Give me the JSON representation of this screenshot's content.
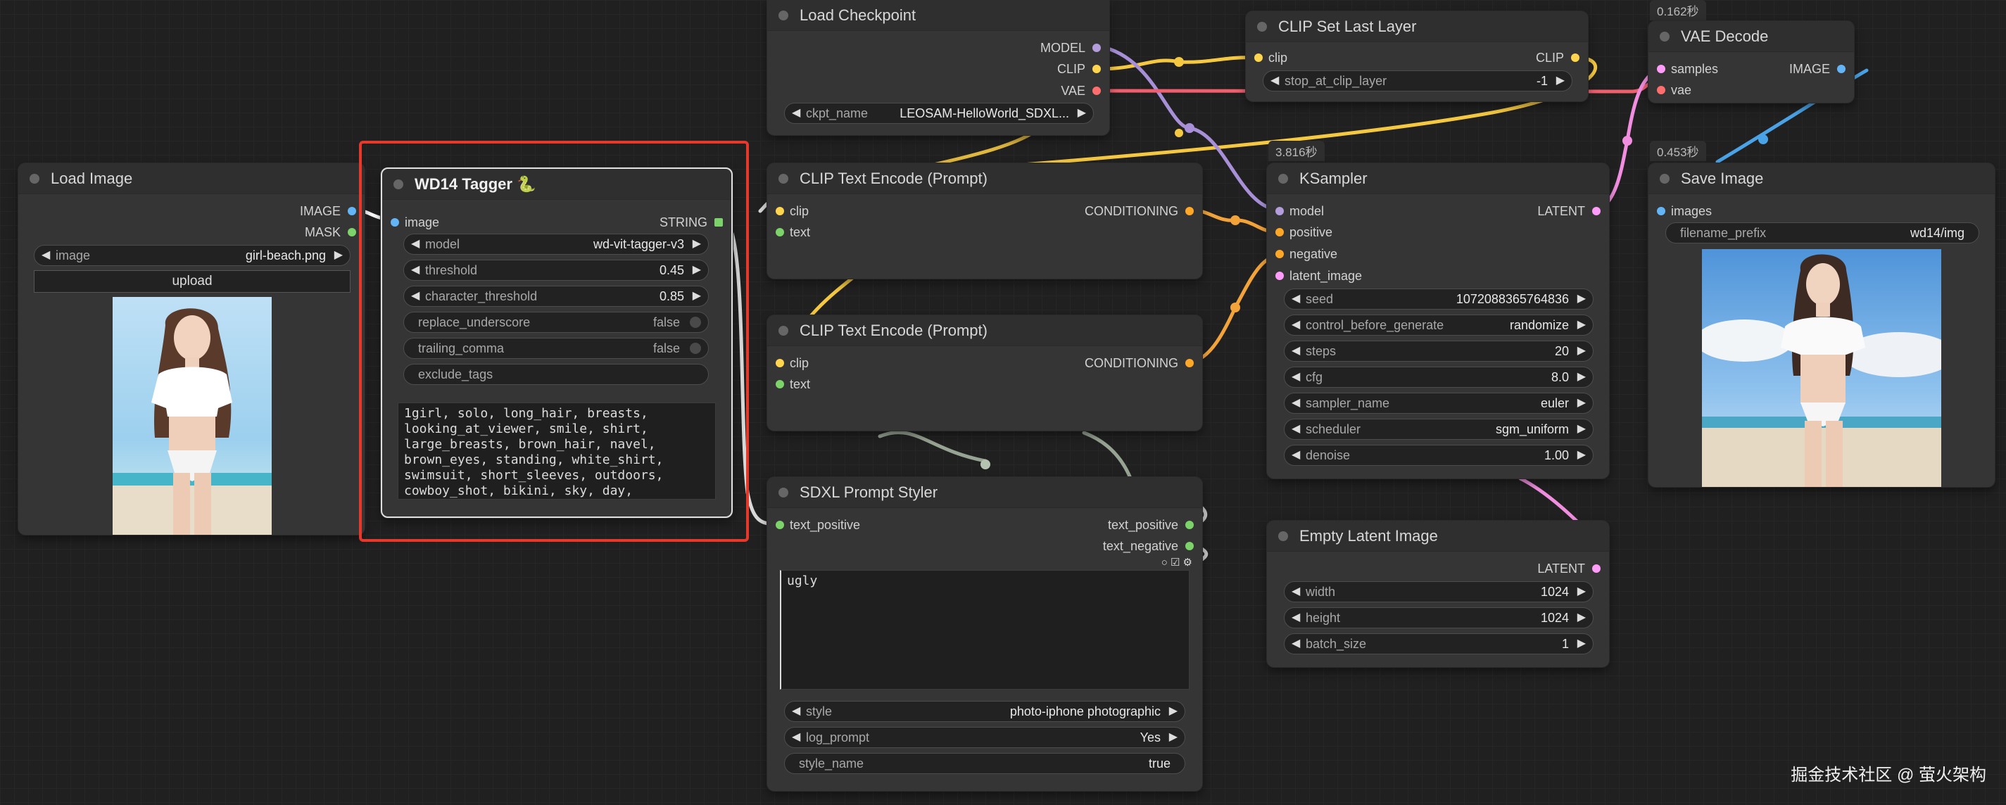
{
  "colors": {
    "model": "#b39ddb",
    "clip": "#ffd54f",
    "vae": "#ff6e6e",
    "conditioning": "#ffa726",
    "latent": "#ff9cf9",
    "image": "#64b5f6",
    "string": "#7bd36a",
    "highlight": "#e8382c"
  },
  "load_image": {
    "title": "Load Image",
    "out_image": "IMAGE",
    "out_mask": "MASK",
    "image_label": "image",
    "image_value": "girl-beach.png",
    "upload_label": "upload"
  },
  "wd14": {
    "title": "WD14 Tagger 🐍",
    "in_image": "image",
    "out_string": "STRING",
    "model_label": "model",
    "model_value": "wd-vit-tagger-v3",
    "threshold_label": "threshold",
    "threshold_value": "0.45",
    "char_label": "character_threshold",
    "char_value": "0.85",
    "replace_label": "replace_underscore",
    "replace_value": "false",
    "trailing_label": "trailing_comma",
    "trailing_value": "false",
    "exclude_label": "exclude_tags",
    "tags_text": "1girl, solo, long_hair, breasts,\nlooking_at_viewer, smile, shirt,\nlarge_breasts, brown_hair, navel,\nbrown_eyes, standing, white_shirt,\nswimsuit, short_sleeves, outdoors,\ncowboy_shot, bikini, sky, day,"
  },
  "load_checkpoint": {
    "title": "Load Checkpoint",
    "out_model": "MODEL",
    "out_clip": "CLIP",
    "out_vae": "VAE",
    "ckpt_label": "ckpt_name",
    "ckpt_value": "LEOSAM-HelloWorld_SDXL..."
  },
  "clip_text_1": {
    "title": "CLIP Text Encode (Prompt)",
    "in_clip": "clip",
    "in_text": "text",
    "out": "CONDITIONING"
  },
  "clip_text_2": {
    "title": "CLIP Text Encode (Prompt)",
    "in_clip": "clip",
    "in_text": "text",
    "out": "CONDITIONING"
  },
  "sdxl_styler": {
    "title": "SDXL Prompt Styler",
    "in_text_positive": "text_positive",
    "out_text_positive": "text_positive",
    "out_text_negative": "text_negative",
    "text": "ugly",
    "style_label": "style",
    "style_value": "photo-iphone photographic",
    "log_label": "log_prompt",
    "log_value": "Yes",
    "style_name_label": "style_name",
    "style_name_value": "true"
  },
  "clip_set_last": {
    "title": "CLIP Set Last Layer",
    "in_clip": "clip",
    "out_clip": "CLIP",
    "stop_label": "stop_at_clip_layer",
    "stop_value": "-1"
  },
  "ksampler": {
    "time": "3.816秒",
    "title": "KSampler",
    "in_model": "model",
    "in_positive": "positive",
    "in_negative": "negative",
    "in_latent": "latent_image",
    "out_latent": "LATENT",
    "seed_label": "seed",
    "seed_value": "1072088365764836",
    "control_label": "control_before_generate",
    "control_value": "randomize",
    "steps_label": "steps",
    "steps_value": "20",
    "cfg_label": "cfg",
    "cfg_value": "8.0",
    "sampler_label": "sampler_name",
    "sampler_value": "euler",
    "scheduler_label": "scheduler",
    "scheduler_value": "sgm_uniform",
    "denoise_label": "denoise",
    "denoise_value": "1.00"
  },
  "empty_latent": {
    "title": "Empty Latent Image",
    "out_latent": "LATENT",
    "width_label": "width",
    "width_value": "1024",
    "height_label": "height",
    "height_value": "1024",
    "batch_label": "batch_size",
    "batch_value": "1"
  },
  "vae_decode": {
    "time": "0.162秒",
    "title": "VAE Decode",
    "in_samples": "samples",
    "in_vae": "vae",
    "out_image": "IMAGE"
  },
  "save_image": {
    "time": "0.453秒",
    "title": "Save Image",
    "in_images": "images",
    "prefix_label": "filename_prefix",
    "prefix_value": "wd14/img"
  },
  "watermark": "掘金技术社区 @ 萤火架构"
}
